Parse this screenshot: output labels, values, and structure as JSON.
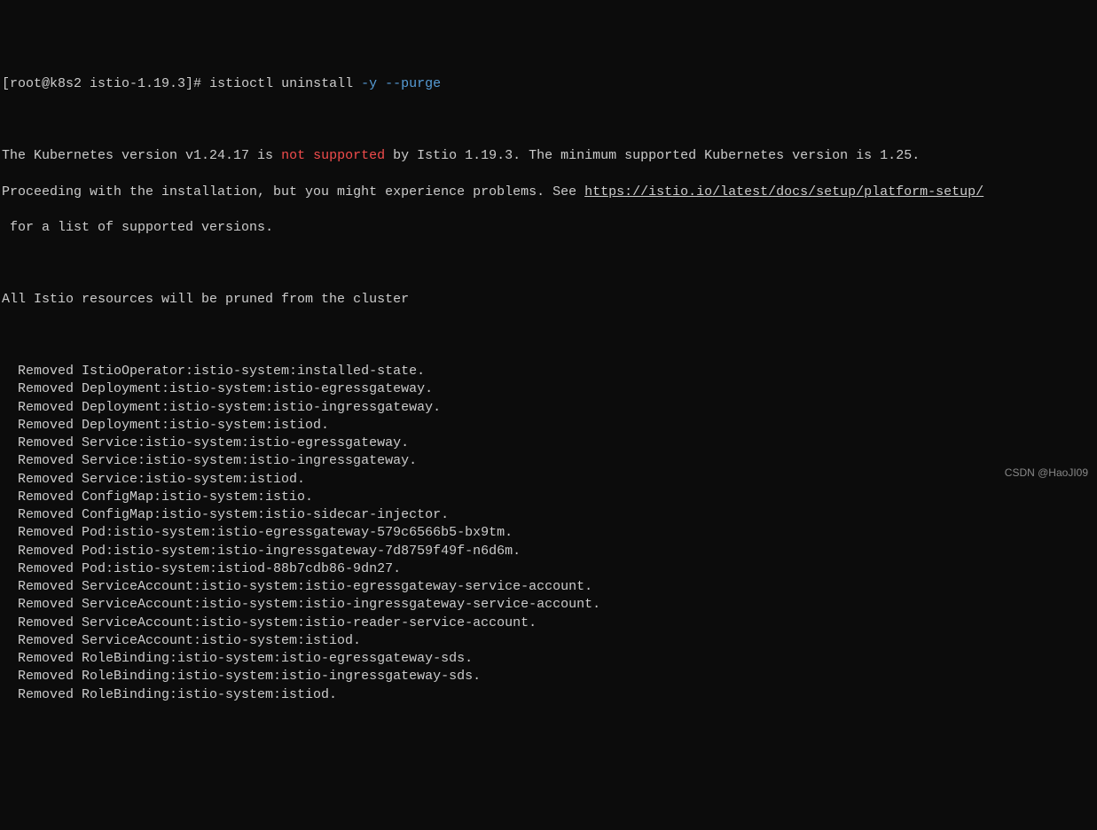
{
  "prompt": {
    "user_host": "[root@k8s2 istio-1.19.3]#",
    "command": "istioctl uninstall",
    "options": "-y --purge"
  },
  "warning": {
    "line1_pre": "The Kubernetes version v1.24.17 is ",
    "line1_err": "not supported",
    "line1_post": " by Istio 1.19.3. The minimum supported Kubernetes version is 1.25.",
    "line2_pre": "Proceeding with the installation, but you might experience problems. See ",
    "line2_link": "https://istio.io/latest/docs/setup/platform-setup/",
    "line3": " for a list of supported versions."
  },
  "prune_header": "All Istio resources will be pruned from the cluster",
  "removed": [
    "Removed IstioOperator:istio-system:installed-state.",
    "Removed Deployment:istio-system:istio-egressgateway.",
    "Removed Deployment:istio-system:istio-ingressgateway.",
    "Removed Deployment:istio-system:istiod.",
    "Removed Service:istio-system:istio-egressgateway.",
    "Removed Service:istio-system:istio-ingressgateway.",
    "Removed Service:istio-system:istiod.",
    "Removed ConfigMap:istio-system:istio.",
    "Removed ConfigMap:istio-system:istio-sidecar-injector.",
    "Removed Pod:istio-system:istio-egressgateway-579c6566b5-bx9tm.",
    "Removed Pod:istio-system:istio-ingressgateway-7d8759f49f-n6d6m.",
    "Removed Pod:istio-system:istiod-88b7cdb86-9dn27.",
    "Removed ServiceAccount:istio-system:istio-egressgateway-service-account.",
    "Removed ServiceAccount:istio-system:istio-ingressgateway-service-account.",
    "Removed ServiceAccount:istio-system:istio-reader-service-account.",
    "Removed ServiceAccount:istio-system:istiod.",
    "Removed RoleBinding:istio-system:istio-egressgateway-sds.",
    "Removed RoleBinding:istio-system:istio-ingressgateway-sds.",
    "Removed RoleBinding:istio-system:istiod."
  ],
  "watermark": "CSDN @HaoJI09"
}
